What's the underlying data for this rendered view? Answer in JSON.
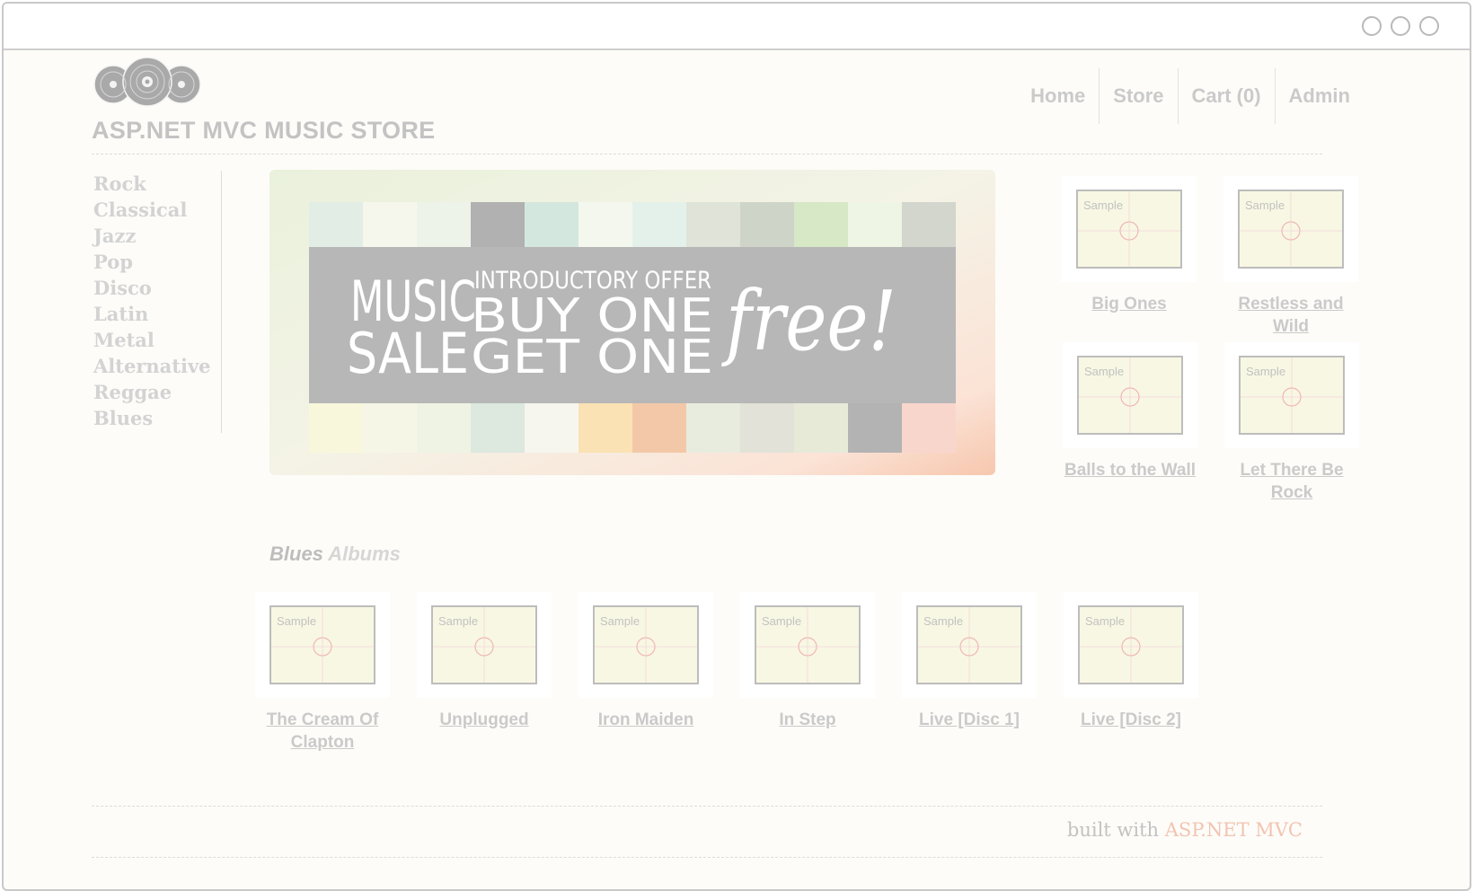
{
  "site": {
    "title": "ASP.NET MVC MUSIC STORE"
  },
  "nav": {
    "items": [
      "Home",
      "Store",
      "Cart (0)",
      "Admin"
    ]
  },
  "genres": [
    "Rock",
    "Classical",
    "Jazz",
    "Pop",
    "Disco",
    "Latin",
    "Metal",
    "Alternative",
    "Reggae",
    "Blues"
  ],
  "banner": {
    "line1": "MUSIC",
    "line2": "SALE",
    "offer": "INTRODUCTORY OFFER",
    "buy": "BUY ONE",
    "get": "GET ONE",
    "free": "free!"
  },
  "featured": [
    {
      "title": "Big Ones",
      "thumb_label": "Sample"
    },
    {
      "title": "Restless and Wild",
      "thumb_label": "Sample"
    },
    {
      "title": "Balls to the Wall",
      "thumb_label": "Sample"
    },
    {
      "title": "Let There Be Rock",
      "thumb_label": "Sample"
    }
  ],
  "section": {
    "genre": "Blues",
    "suffix": "Albums"
  },
  "albums": [
    {
      "title": "The Cream Of Clapton",
      "thumb_label": "Sample"
    },
    {
      "title": "Unplugged",
      "thumb_label": "Sample"
    },
    {
      "title": "Iron Maiden",
      "thumb_label": "Sample"
    },
    {
      "title": "In Step",
      "thumb_label": "Sample"
    },
    {
      "title": "Live [Disc 1]",
      "thumb_label": "Sample"
    },
    {
      "title": "Live [Disc 2]",
      "thumb_label": "Sample"
    }
  ],
  "footer": {
    "prefix": "built with",
    "brand": "ASP.NET MVC"
  },
  "colors": {
    "background": "#fdfcf8",
    "text_muted": "#cacaca",
    "footer_brand": "#f2c4b2",
    "thumb_bg": "#f8f7e3"
  }
}
